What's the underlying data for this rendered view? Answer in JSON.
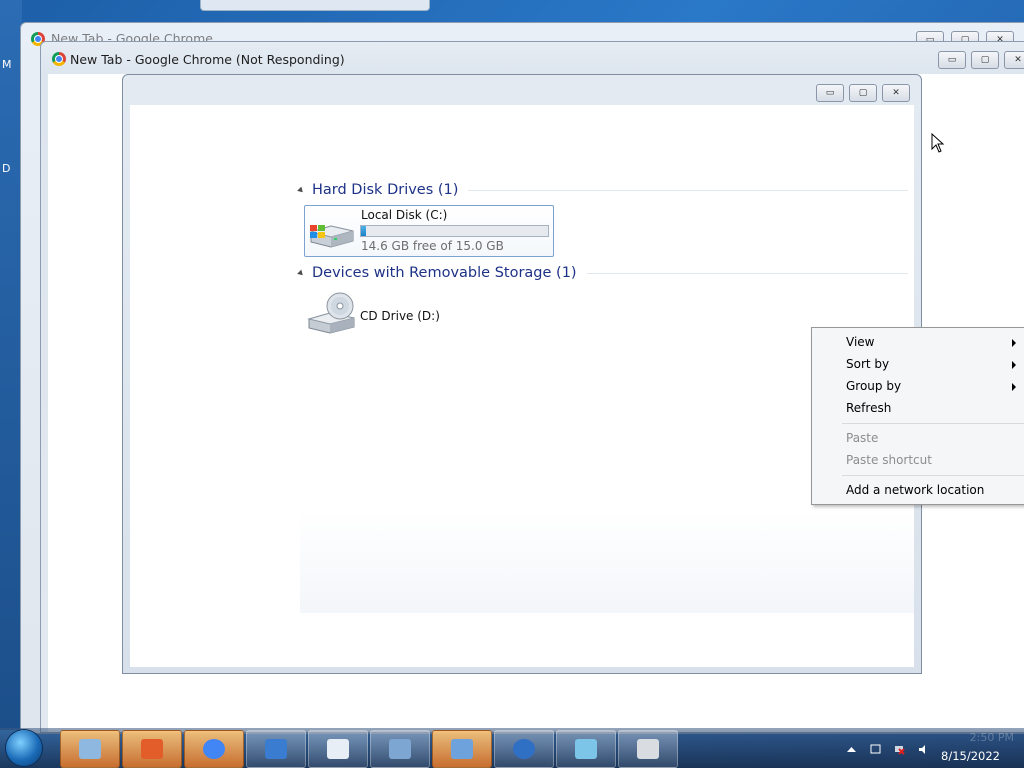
{
  "desktop": {
    "edge_letters": [
      "M",
      "D"
    ]
  },
  "background_window": {
    "title": "New Tab - Google Chrome",
    "controls": {
      "minimize": "▭",
      "maximize": "▢",
      "close": "✕"
    }
  },
  "front_window": {
    "title": "New Tab - Google Chrome (Not Responding)",
    "controls": {
      "minimize": "▭",
      "maximize": "▢",
      "close": "✕"
    }
  },
  "explorer": {
    "controls": {
      "minimize": "▭",
      "maximize": "▢",
      "close": "✕"
    },
    "groups": [
      {
        "label": "Hard Disk Drives (1)"
      },
      {
        "label": "Devices with Removable Storage (1)"
      }
    ],
    "drives": [
      {
        "name": "Local Disk (C:)",
        "free_text": "14.6 GB free of 15.0 GB",
        "used_fraction": 0.027,
        "icon": "hard-drive-icon"
      },
      {
        "name": "CD Drive (D:)",
        "icon": "cd-drive-icon"
      }
    ]
  },
  "context_menu": {
    "items": [
      {
        "label": "View",
        "submenu": true,
        "enabled": true
      },
      {
        "label": "Sort by",
        "submenu": true,
        "enabled": true
      },
      {
        "label": "Group by",
        "submenu": true,
        "enabled": true
      },
      {
        "label": "Refresh",
        "submenu": false,
        "enabled": true
      },
      {
        "label": "Paste",
        "submenu": false,
        "enabled": false
      },
      {
        "label": "Paste shortcut",
        "submenu": false,
        "enabled": false
      },
      {
        "label": "Add a network location",
        "submenu": false,
        "enabled": true
      }
    ]
  },
  "taskbar": {
    "start": "start-orb-icon",
    "buttons": [
      {
        "icon": "file-explorer-icon"
      },
      {
        "icon": "media-player-icon"
      },
      {
        "icon": "chrome-icon"
      },
      {
        "icon": "windows-logo-icon"
      },
      {
        "icon": "document-icon"
      },
      {
        "icon": "calculator-icon"
      },
      {
        "icon": "network-icon"
      },
      {
        "icon": "help-icon"
      },
      {
        "icon": "paint-icon"
      },
      {
        "icon": "printer-icon"
      }
    ],
    "tray": {
      "time": "2:50 PM",
      "date": "8/15/2022",
      "icons": [
        "show-hidden-icons-arrow",
        "action-center-icon",
        "network-error-icon",
        "volume-icon"
      ]
    }
  },
  "colors": {
    "group_header": "#1e3287",
    "capacity_fill": "#1c83c6",
    "taskbar_button": "#e6782a"
  }
}
